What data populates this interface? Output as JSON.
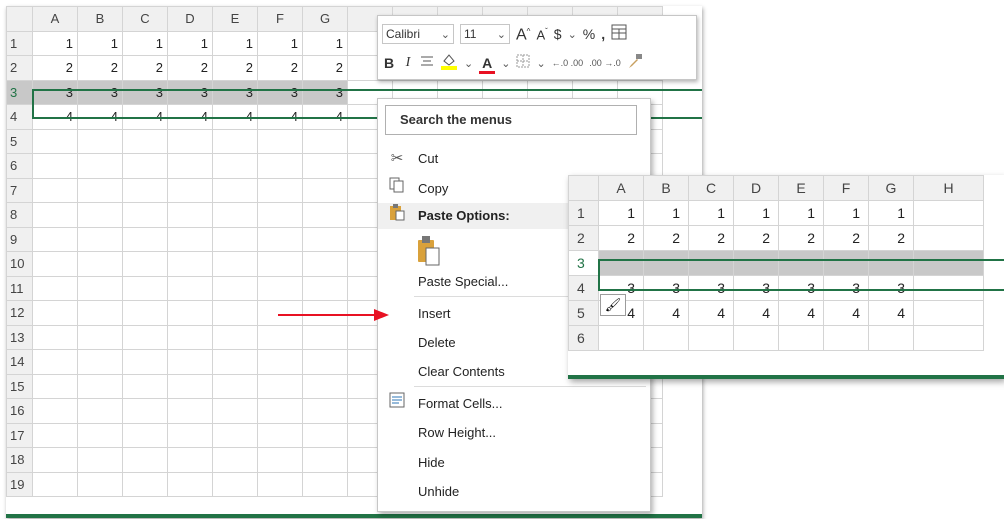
{
  "main_sheet": {
    "columns": [
      "A",
      "B",
      "C",
      "D",
      "E",
      "F",
      "G"
    ],
    "rows": [
      {
        "n": "1",
        "cells": [
          "1",
          "1",
          "1",
          "1",
          "1",
          "1",
          "1"
        ]
      },
      {
        "n": "2",
        "cells": [
          "2",
          "2",
          "2",
          "2",
          "2",
          "2",
          "2"
        ]
      },
      {
        "n": "3",
        "cells": [
          "3",
          "3",
          "3",
          "3",
          "3",
          "3",
          "3"
        ]
      },
      {
        "n": "4",
        "cells": [
          "4",
          "4",
          "4",
          "4",
          "4",
          "4",
          "4"
        ]
      },
      {
        "n": "5",
        "cells": []
      },
      {
        "n": "6",
        "cells": []
      },
      {
        "n": "7",
        "cells": []
      },
      {
        "n": "8",
        "cells": []
      },
      {
        "n": "9",
        "cells": []
      },
      {
        "n": "10",
        "cells": []
      },
      {
        "n": "11",
        "cells": []
      },
      {
        "n": "12",
        "cells": []
      },
      {
        "n": "13",
        "cells": []
      },
      {
        "n": "14",
        "cells": []
      },
      {
        "n": "15",
        "cells": []
      },
      {
        "n": "16",
        "cells": []
      },
      {
        "n": "17",
        "cells": []
      },
      {
        "n": "18",
        "cells": []
      },
      {
        "n": "19",
        "cells": []
      }
    ],
    "selected_row": "3"
  },
  "mini_toolbar": {
    "font_name": "Calibri",
    "font_size": "11",
    "grow_font": "A",
    "shrink_font": "A",
    "currency": "$",
    "percent": "%",
    "comma": ",",
    "bold": "B",
    "italic": "I",
    "font_color_letter": "A",
    "increase_decimal": "←.0 .00",
    "decrease_decimal": ".00 →.0"
  },
  "context_menu": {
    "search_label": "Search the menus",
    "items": [
      {
        "label": "Cut",
        "icon": "scissors-icon"
      },
      {
        "label": "Copy",
        "icon": "copy-icon"
      },
      {
        "label": "Paste Options:",
        "icon": "paste-icon"
      },
      {
        "label": "Paste Special...",
        "icon": ""
      },
      {
        "label": "Insert",
        "icon": ""
      },
      {
        "label": "Delete",
        "icon": ""
      },
      {
        "label": "Clear Contents",
        "icon": ""
      },
      {
        "label": "Format Cells...",
        "icon": "format-cells-icon"
      },
      {
        "label": "Row Height...",
        "icon": ""
      },
      {
        "label": "Hide",
        "icon": ""
      },
      {
        "label": "Unhide",
        "icon": ""
      }
    ]
  },
  "result_sheet": {
    "columns": [
      "A",
      "B",
      "C",
      "D",
      "E",
      "F",
      "G",
      "H"
    ],
    "rows": [
      {
        "n": "1",
        "cells": [
          "1",
          "1",
          "1",
          "1",
          "1",
          "1",
          "1"
        ]
      },
      {
        "n": "2",
        "cells": [
          "2",
          "2",
          "2",
          "2",
          "2",
          "2",
          "2"
        ]
      },
      {
        "n": "3",
        "cells": []
      },
      {
        "n": "4",
        "cells": [
          "3",
          "3",
          "3",
          "3",
          "3",
          "3",
          "3"
        ]
      },
      {
        "n": "5",
        "cells": [
          "4",
          "4",
          "4",
          "4",
          "4",
          "4",
          "4"
        ]
      },
      {
        "n": "6",
        "cells": []
      }
    ],
    "inserted_row": "3"
  },
  "colors": {
    "accent": "#217346",
    "arrow": "#e81123",
    "selection_fill": "#c8c8c8"
  }
}
